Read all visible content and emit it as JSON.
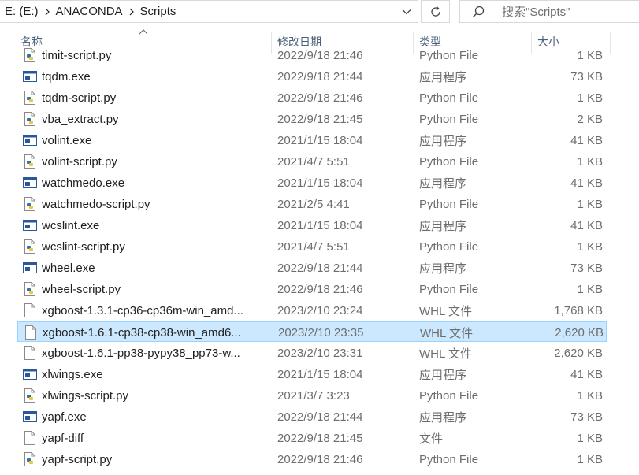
{
  "address_bar": {
    "crumbs": [
      "E: (E:)",
      "ANACONDA",
      "Scripts"
    ]
  },
  "search": {
    "placeholder": "搜索\"Scripts\""
  },
  "columns": {
    "name": "名称",
    "date": "修改日期",
    "type": "类型",
    "size": "大小"
  },
  "files": [
    {
      "name": "timit-script.py",
      "date": "2022/9/18 21:46",
      "type": "Python File",
      "size": "1 KB",
      "icon": "python-file-icon"
    },
    {
      "name": "tqdm.exe",
      "date": "2022/9/18 21:44",
      "type": "应用程序",
      "size": "73 KB",
      "icon": "exe-file-icon"
    },
    {
      "name": "tqdm-script.py",
      "date": "2022/9/18 21:46",
      "type": "Python File",
      "size": "1 KB",
      "icon": "python-file-icon"
    },
    {
      "name": "vba_extract.py",
      "date": "2022/9/18 21:45",
      "type": "Python File",
      "size": "2 KB",
      "icon": "python-file-icon"
    },
    {
      "name": "volint.exe",
      "date": "2021/1/15 18:04",
      "type": "应用程序",
      "size": "41 KB",
      "icon": "exe-file-icon"
    },
    {
      "name": "volint-script.py",
      "date": "2021/4/7 5:51",
      "type": "Python File",
      "size": "1 KB",
      "icon": "python-file-icon"
    },
    {
      "name": "watchmedo.exe",
      "date": "2021/1/15 18:04",
      "type": "应用程序",
      "size": "41 KB",
      "icon": "exe-file-icon"
    },
    {
      "name": "watchmedo-script.py",
      "date": "2021/2/5 4:41",
      "type": "Python File",
      "size": "1 KB",
      "icon": "python-file-icon"
    },
    {
      "name": "wcslint.exe",
      "date": "2021/1/15 18:04",
      "type": "应用程序",
      "size": "41 KB",
      "icon": "exe-file-icon"
    },
    {
      "name": "wcslint-script.py",
      "date": "2021/4/7 5:51",
      "type": "Python File",
      "size": "1 KB",
      "icon": "python-file-icon"
    },
    {
      "name": "wheel.exe",
      "date": "2022/9/18 21:44",
      "type": "应用程序",
      "size": "73 KB",
      "icon": "exe-file-icon"
    },
    {
      "name": "wheel-script.py",
      "date": "2022/9/18 21:46",
      "type": "Python File",
      "size": "1 KB",
      "icon": "python-file-icon"
    },
    {
      "name": "xgboost-1.3.1-cp36-cp36m-win_amd...",
      "date": "2023/2/10 23:24",
      "type": "WHL 文件",
      "size": "1,768 KB",
      "icon": "generic-file-icon"
    },
    {
      "name": "xgboost-1.6.1-cp38-cp38-win_amd6...",
      "date": "2023/2/10 23:35",
      "type": "WHL 文件",
      "size": "2,620 KB",
      "icon": "generic-file-icon",
      "selected": true
    },
    {
      "name": "xgboost-1.6.1-pp38-pypy38_pp73-w...",
      "date": "2023/2/10 23:31",
      "type": "WHL 文件",
      "size": "2,620 KB",
      "icon": "generic-file-icon"
    },
    {
      "name": "xlwings.exe",
      "date": "2021/1/15 18:04",
      "type": "应用程序",
      "size": "41 KB",
      "icon": "exe-file-icon"
    },
    {
      "name": "xlwings-script.py",
      "date": "2021/3/7 3:23",
      "type": "Python File",
      "size": "1 KB",
      "icon": "python-file-icon"
    },
    {
      "name": "yapf.exe",
      "date": "2022/9/18 21:44",
      "type": "应用程序",
      "size": "73 KB",
      "icon": "exe-file-icon"
    },
    {
      "name": "yapf-diff",
      "date": "2022/9/18 21:45",
      "type": "文件",
      "size": "1 KB",
      "icon": "generic-file-icon"
    },
    {
      "name": "yapf-script.py",
      "date": "2022/9/18 21:46",
      "type": "Python File",
      "size": "1 KB",
      "icon": "python-file-icon"
    }
  ],
  "colors": {
    "selection_bg": "#cce8ff",
    "selection_border": "#99d1ff",
    "header_text": "#4c607a",
    "secondary_text": "#6d6d6d"
  }
}
